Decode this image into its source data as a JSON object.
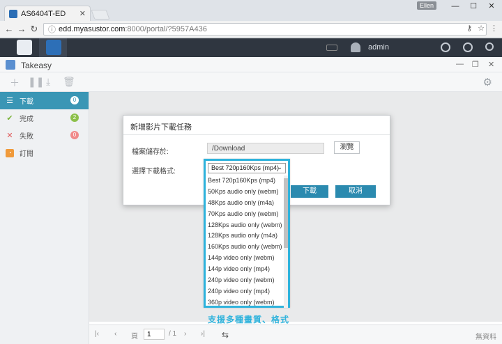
{
  "browser": {
    "tab_title": "AS6404T-ED",
    "user_chip": "Ellen",
    "url_host": "edd.myasustor.com",
    "url_path": ":8000/portal/?5957A436"
  },
  "nas": {
    "username": "admin"
  },
  "app": {
    "title": "Takeasy"
  },
  "sidebar": {
    "items": [
      {
        "label": "下載",
        "count": "0",
        "badge_color": "#ffffff"
      },
      {
        "label": "完成",
        "count": "2",
        "badge_color": "#8cc04a"
      },
      {
        "label": "失敗",
        "count": "0",
        "badge_color": "#f08a8a"
      },
      {
        "label": "訂閱",
        "count": "",
        "badge_color": ""
      }
    ]
  },
  "pager": {
    "page_prefix": "頁",
    "page_value": "1",
    "page_total": "/ 1",
    "no_data": "無資料"
  },
  "dialog": {
    "title": "新增影片下載任務",
    "save_label": "檔案儲存於:",
    "save_path": "/Download",
    "browse_label": "瀏覽",
    "format_label": "選擇下載格式:",
    "download_label": "下載",
    "cancel_label": "取消"
  },
  "dropdown": {
    "selected": "Best 720p160Kps (mp4)",
    "options": [
      "Best 720p160Kps (mp4)",
      "50Kps audio only (webm)",
      "48Kps audio only (m4a)",
      "70Kps audio only (webm)",
      "128Kps audio only (webm)",
      "128Kps audio only (m4a)",
      "160Kps audio only (webm)",
      "144p video only (webm)",
      "144p video only (mp4)",
      "240p video only (webm)",
      "240p video only (mp4)",
      "360p video only (webm)"
    ]
  },
  "caption": "支援多種畫質、格式"
}
